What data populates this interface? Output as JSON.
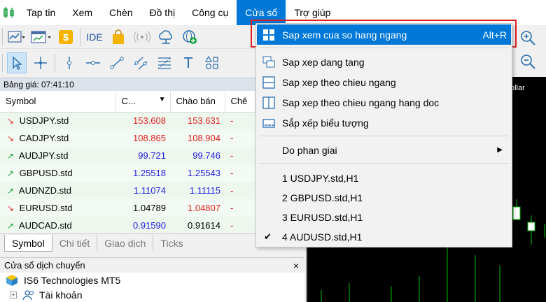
{
  "menubar": {
    "items": [
      "Tap tin",
      "Xem",
      "Chèn",
      "Đồ thị",
      "Công cụ",
      "Cửa sổ",
      "Trợ giúp"
    ]
  },
  "toolbar": {
    "ide_label": "IDE",
    "text_tool_label": "T"
  },
  "market_watch": {
    "title": "Bảng giá: 07:41:10",
    "headers": [
      "Symbol",
      "C...",
      "Chào bán",
      "Chê"
    ],
    "rows": [
      {
        "symbol": "USDJPY.std",
        "bid": "153.608",
        "ask": "153.631",
        "ext": "-",
        "dir": "down"
      },
      {
        "symbol": "CADJPY.std",
        "bid": "108.865",
        "ask": "108.904",
        "ext": "-",
        "dir": "down"
      },
      {
        "symbol": "AUDJPY.std",
        "bid": "99.721",
        "ask": "99.746",
        "ext": "-",
        "dir": "up"
      },
      {
        "symbol": "GBPUSD.std",
        "bid": "1.25518",
        "ask": "1.25543",
        "ext": "-",
        "dir": "up"
      },
      {
        "symbol": "AUDNZD.std",
        "bid": "1.11074",
        "ask": "1.11115",
        "ext": "-",
        "dir": "up"
      },
      {
        "symbol": "EURUSD.std",
        "bid": "1.04789",
        "ask": "1.04807",
        "ext": "-",
        "dir": "down"
      },
      {
        "symbol": "AUDCAD.std",
        "bid": "0.91590",
        "ask": "0.91614",
        "ext": "-",
        "dir": "up"
      }
    ],
    "tabs": [
      "Symbol",
      "Chi tiết",
      "Giao dịch",
      "Ticks"
    ]
  },
  "navigator": {
    "title": "Cửa sổ dịch chuyển",
    "close": "×",
    "items": [
      "IS6 Technologies MT5",
      "Tài khoản"
    ]
  },
  "chart": {
    "label": "ollar"
  },
  "window_menu": {
    "items": [
      {
        "label": "Sap xem cua so hang ngang",
        "shortcut": "Alt+R"
      },
      {
        "label": "Sap xep dang tang"
      },
      {
        "label": "Sap xep theo chieu ngang"
      },
      {
        "label": "Sap xep theo chieu ngang hang doc"
      },
      {
        "label": "Sắp xếp biểu tượng"
      },
      {
        "label": "Do phan giai"
      },
      {
        "label": "1 USDJPY.std,H1"
      },
      {
        "label": "2 GBPUSD.std,H1"
      },
      {
        "label": "3 EURUSD.std,H1"
      },
      {
        "label": "4 AUDUSD.std,H1",
        "checked": "✔"
      }
    ]
  },
  "colors": {
    "accent": "#0078d7",
    "highlight_border": "#e02020",
    "price_red": "#e02020",
    "price_blue": "#2020e0",
    "chart_bg": "#000000",
    "candle_green": "#00c000"
  }
}
